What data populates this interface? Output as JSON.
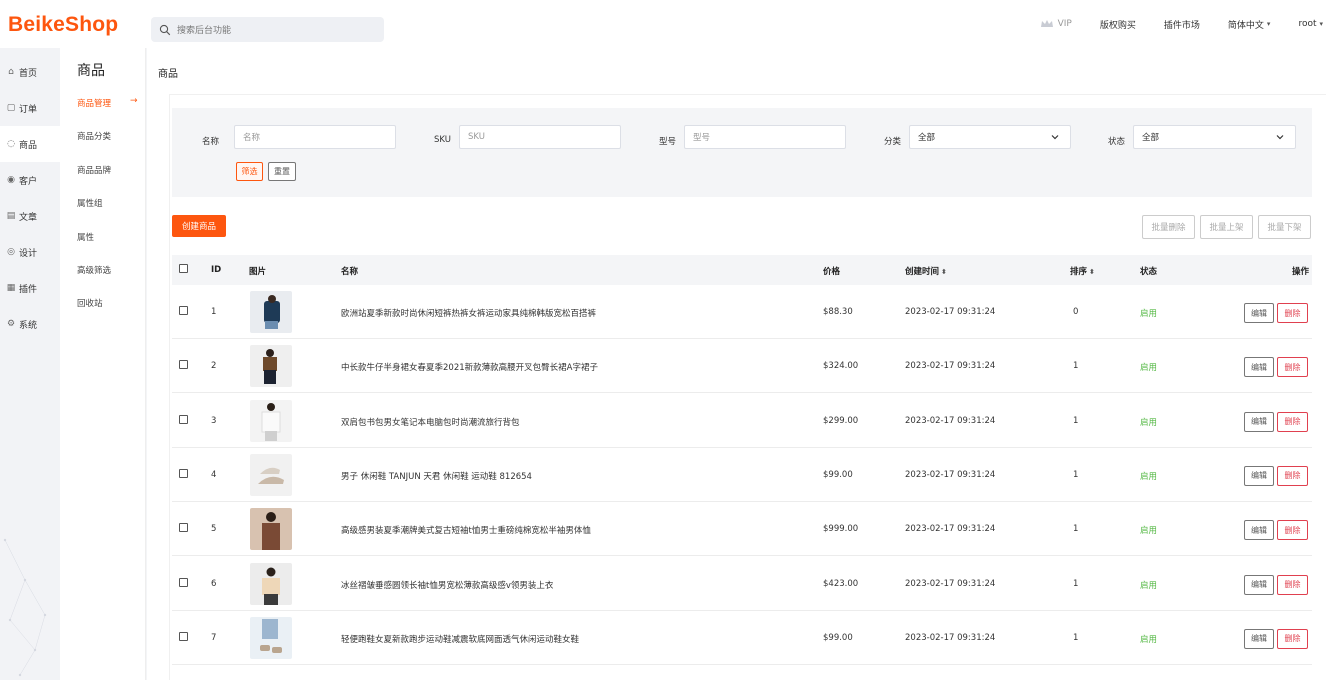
{
  "header": {
    "logo": "BeikeShop",
    "search_placeholder": "搜索后台功能",
    "vip": "VIP",
    "nav": [
      "版权购买",
      "插件市场",
      "简体中文",
      "root"
    ]
  },
  "leftnav": [
    {
      "label": "首页",
      "icon": "home-icon",
      "glyph": "⌂"
    },
    {
      "label": "订单",
      "icon": "order-icon",
      "glyph": "▢"
    },
    {
      "label": "商品",
      "icon": "product-icon",
      "glyph": "◌"
    },
    {
      "label": "客户",
      "icon": "customer-icon",
      "glyph": "◉"
    },
    {
      "label": "文章",
      "icon": "article-icon",
      "glyph": "▤"
    },
    {
      "label": "设计",
      "icon": "design-icon",
      "glyph": "◎"
    },
    {
      "label": "插件",
      "icon": "plugin-icon",
      "glyph": "▦"
    },
    {
      "label": "系统",
      "icon": "system-icon",
      "glyph": "⚙"
    }
  ],
  "subnav": {
    "title": "商品",
    "items": [
      "商品管理",
      "商品分类",
      "商品品牌",
      "属性组",
      "属性",
      "高级筛选",
      "回收站"
    ]
  },
  "breadcrumb": "商品",
  "filter": {
    "name_label": "名称",
    "name_placeholder": "名称",
    "sku_label": "SKU",
    "sku_placeholder": "SKU",
    "model_label": "型号",
    "model_placeholder": "型号",
    "category_label": "分类",
    "category_value": "全部",
    "status_label": "状态",
    "status_value": "全部",
    "filter_btn": "筛选",
    "reset_btn": "重置"
  },
  "actions": {
    "create": "创建商品",
    "batch_delete": "批量删除",
    "batch_on": "批量上架",
    "batch_off": "批量下架"
  },
  "table": {
    "headers": {
      "id": "ID",
      "image": "图片",
      "name": "名称",
      "price": "价格",
      "created": "创建时间",
      "sort": "排序",
      "status": "状态",
      "op": "操作"
    },
    "edit_label": "编辑",
    "delete_label": "删除",
    "rows": [
      {
        "id": "1",
        "name": "欧洲站夏季新款时尚休闲短裤热裤女裤运动家具纯棉韩版宽松百搭裤",
        "price": "$88.30",
        "created": "2023-02-17 09:31:24",
        "sort": "0",
        "status": "启用"
      },
      {
        "id": "2",
        "name": "中长款牛仔半身裙女春夏季2021新款薄款高腰开叉包臀长裙A字裙子",
        "price": "$324.00",
        "created": "2023-02-17 09:31:24",
        "sort": "1",
        "status": "启用"
      },
      {
        "id": "3",
        "name": "双肩包书包男女笔记本电脑包时尚潮流旅行背包",
        "price": "$299.00",
        "created": "2023-02-17 09:31:24",
        "sort": "1",
        "status": "启用"
      },
      {
        "id": "4",
        "name": "男子 休闲鞋 TANJUN 天君 休闲鞋 运动鞋 812654",
        "price": "$99.00",
        "created": "2023-02-17 09:31:24",
        "sort": "1",
        "status": "启用"
      },
      {
        "id": "5",
        "name": "高级感男装夏季潮牌美式复古短袖t恤男士重磅纯棉宽松半袖男体恤",
        "price": "$999.00",
        "created": "2023-02-17 09:31:24",
        "sort": "1",
        "status": "启用"
      },
      {
        "id": "6",
        "name": "冰丝褶皱垂感圆领长袖t恤男宽松薄款高级感v领男装上衣",
        "price": "$423.00",
        "created": "2023-02-17 09:31:24",
        "sort": "1",
        "status": "启用"
      },
      {
        "id": "7",
        "name": "轻便跑鞋女夏新款跑步运动鞋减震软底网面透气休闲运动鞋女鞋",
        "price": "$99.00",
        "created": "2023-02-17 09:31:24",
        "sort": "1",
        "status": "启用"
      }
    ]
  },
  "colors": {
    "brand": "#fd560f",
    "status_on": "#54b844",
    "danger": "#e0404f"
  }
}
